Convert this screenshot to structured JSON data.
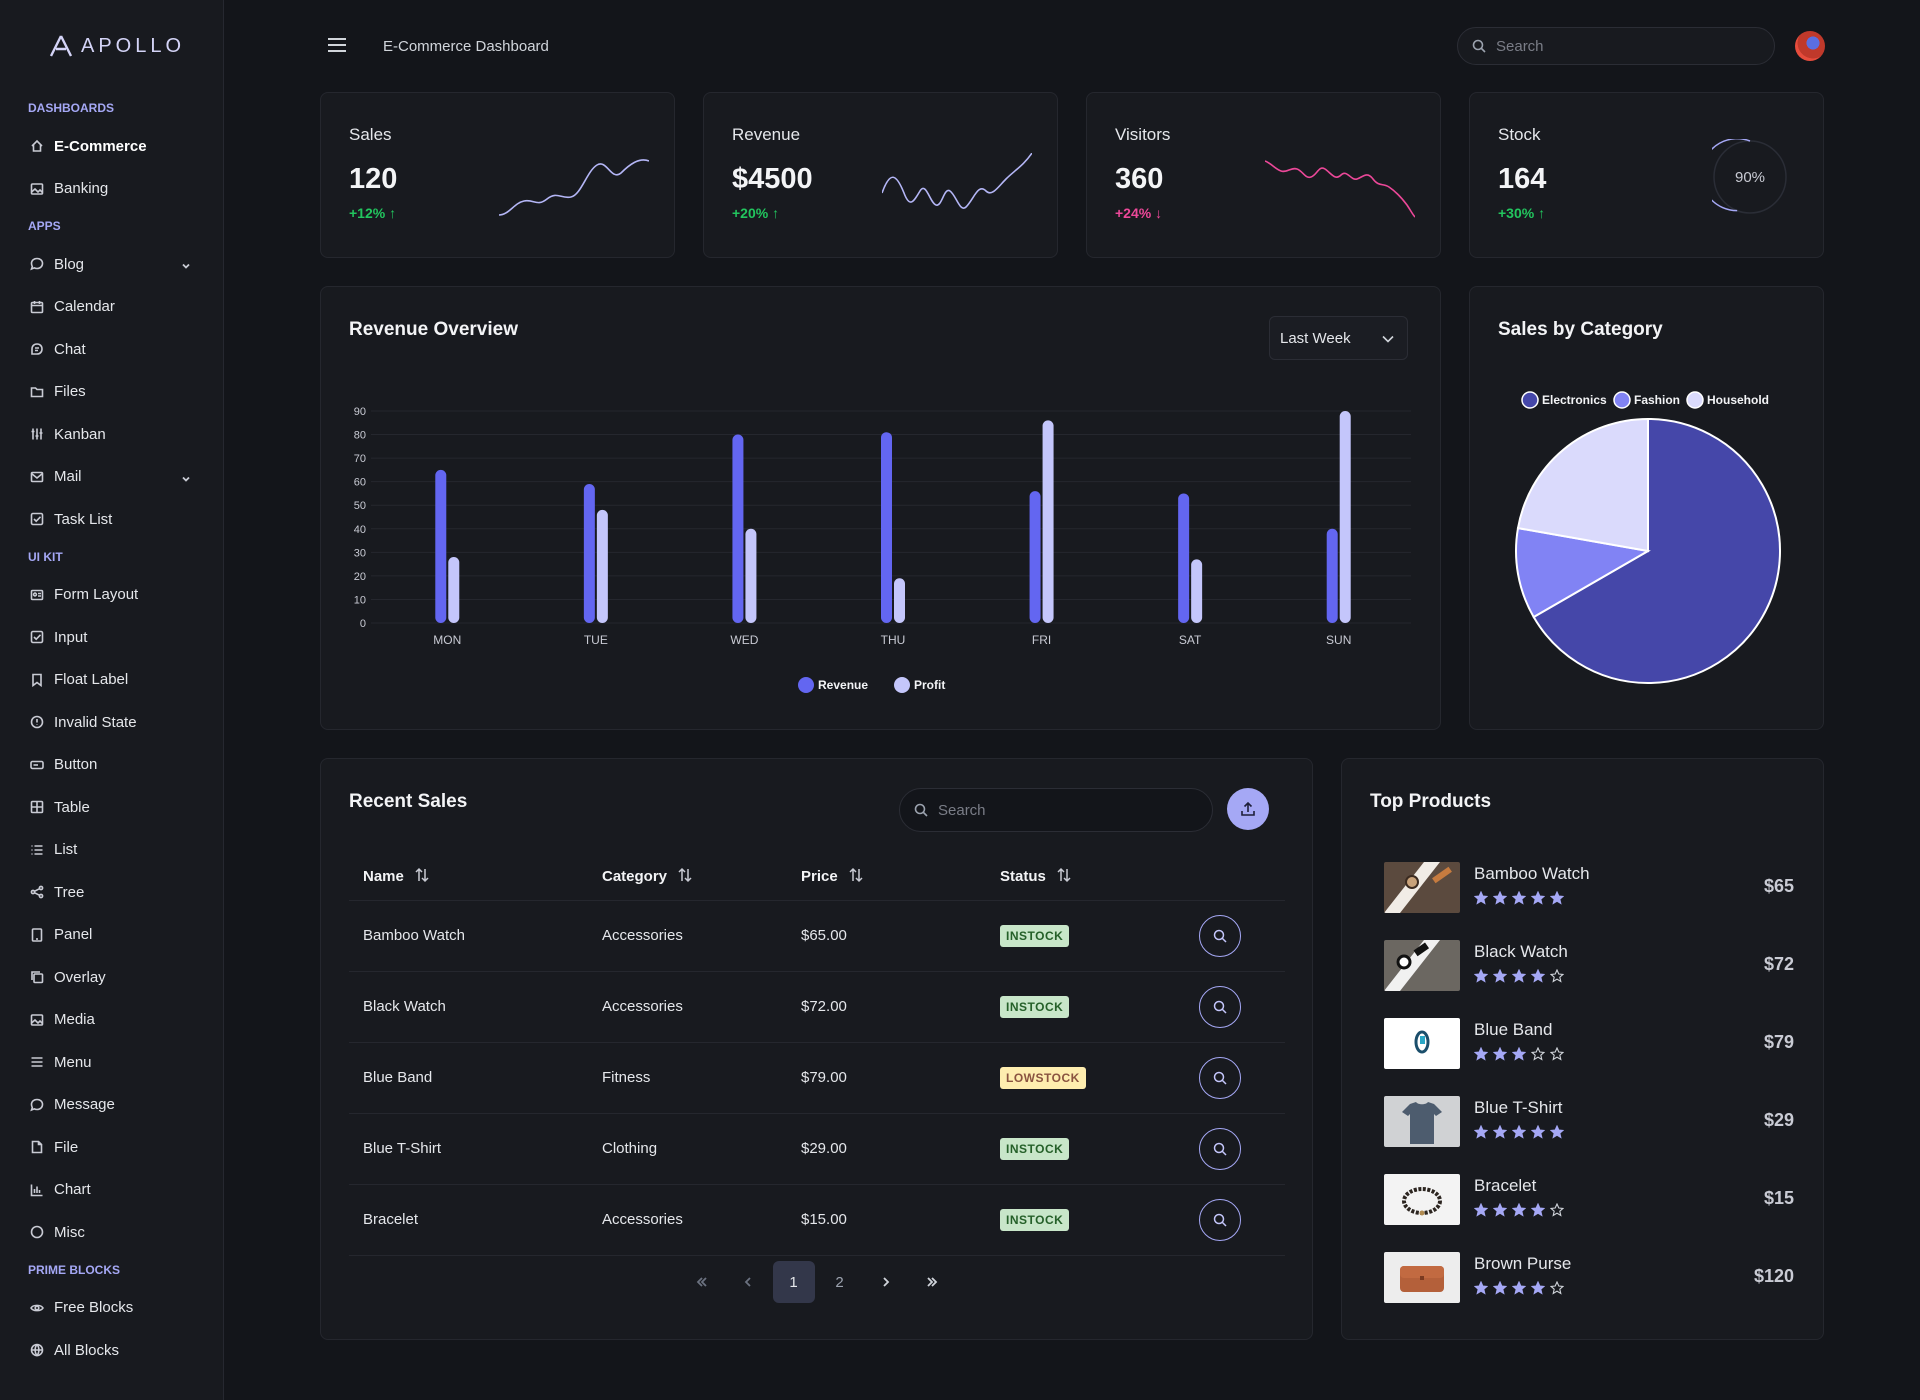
{
  "app": {
    "name": "APOLLO"
  },
  "sidebar": {
    "sections": [
      {
        "title": "DASHBOARDS",
        "items": [
          {
            "label": "E-Commerce",
            "icon": "home-icon",
            "active": true
          },
          {
            "label": "Banking",
            "icon": "image-icon"
          }
        ]
      },
      {
        "title": "APPS",
        "items": [
          {
            "label": "Blog",
            "icon": "comment-icon",
            "expandable": true
          },
          {
            "label": "Calendar",
            "icon": "calendar-icon"
          },
          {
            "label": "Chat",
            "icon": "chat-icon"
          },
          {
            "label": "Files",
            "icon": "folder-icon"
          },
          {
            "label": "Kanban",
            "icon": "sliders-icon"
          },
          {
            "label": "Mail",
            "icon": "envelope-icon",
            "expandable": true
          },
          {
            "label": "Task List",
            "icon": "check-square-icon"
          }
        ]
      },
      {
        "title": "UI KIT",
        "items": [
          {
            "label": "Form Layout",
            "icon": "id-card-icon"
          },
          {
            "label": "Input",
            "icon": "check-square-icon"
          },
          {
            "label": "Float Label",
            "icon": "bookmark-icon"
          },
          {
            "label": "Invalid State",
            "icon": "exclamation-circle-icon"
          },
          {
            "label": "Button",
            "icon": "button-icon"
          },
          {
            "label": "Table",
            "icon": "table-icon"
          },
          {
            "label": "List",
            "icon": "list-icon"
          },
          {
            "label": "Tree",
            "icon": "share-icon"
          },
          {
            "label": "Panel",
            "icon": "tablet-icon"
          },
          {
            "label": "Overlay",
            "icon": "clone-icon"
          },
          {
            "label": "Media",
            "icon": "image-icon"
          },
          {
            "label": "Menu",
            "icon": "bars-icon"
          },
          {
            "label": "Message",
            "icon": "comment-icon"
          },
          {
            "label": "File",
            "icon": "file-icon"
          },
          {
            "label": "Chart",
            "icon": "chart-bar-icon"
          },
          {
            "label": "Misc",
            "icon": "circle-icon"
          }
        ]
      },
      {
        "title": "PRIME BLOCKS",
        "items": [
          {
            "label": "Free Blocks",
            "icon": "eye-icon"
          },
          {
            "label": "All Blocks",
            "icon": "globe-icon"
          }
        ]
      }
    ]
  },
  "topbar": {
    "title": "E-Commerce Dashboard",
    "search_placeholder": "Search"
  },
  "stats": [
    {
      "title": "Sales",
      "value": "120",
      "change": "+12%",
      "direction": "up"
    },
    {
      "title": "Revenue",
      "value": "$4500",
      "change": "+20%",
      "direction": "up"
    },
    {
      "title": "Visitors",
      "value": "360",
      "change": "+24%",
      "direction": "down"
    },
    {
      "title": "Stock",
      "value": "164",
      "change": "+30%",
      "direction": "up",
      "gauge_label": "90%",
      "gauge_value": 0.9
    }
  ],
  "colors": {
    "accent": "#a5a8f5",
    "revenue": "#6366f1",
    "profit": "#c4c6fb",
    "up": "#22c55e",
    "down": "#ec4899",
    "electronics": "#4547a9",
    "fashion": "#8183f4",
    "household": "#dadafc"
  },
  "revenue_overview": {
    "title": "Revenue Overview",
    "period": "Last Week",
    "chart_data": {
      "type": "bar",
      "categories": [
        "MON",
        "TUE",
        "WED",
        "THU",
        "FRI",
        "SAT",
        "SUN"
      ],
      "series": [
        {
          "name": "Revenue",
          "values": [
            65,
            59,
            80,
            81,
            56,
            55,
            40
          ]
        },
        {
          "name": "Profit",
          "values": [
            28,
            48,
            40,
            19,
            86,
            27,
            90
          ]
        }
      ],
      "ylim": [
        0,
        90
      ],
      "yticks": [
        0,
        10,
        20,
        30,
        40,
        50,
        60,
        70,
        80,
        90
      ],
      "legend": "bottom",
      "grid": true
    }
  },
  "sales_by_category": {
    "title": "Sales by Category",
    "chart_data": {
      "type": "pie",
      "labels": [
        "Electronics",
        "Fashion",
        "Household"
      ],
      "values": [
        300,
        50,
        100
      ],
      "legend": "top"
    }
  },
  "recent_sales": {
    "title": "Recent Sales",
    "search_placeholder": "Search",
    "columns": [
      "Name",
      "Category",
      "Price",
      "Status"
    ],
    "rows": [
      {
        "name": "Bamboo Watch",
        "category": "Accessories",
        "price": "$65.00",
        "status": "INSTOCK"
      },
      {
        "name": "Black Watch",
        "category": "Accessories",
        "price": "$72.00",
        "status": "INSTOCK"
      },
      {
        "name": "Blue Band",
        "category": "Fitness",
        "price": "$79.00",
        "status": "LOWSTOCK"
      },
      {
        "name": "Blue T-Shirt",
        "category": "Clothing",
        "price": "$29.00",
        "status": "INSTOCK"
      },
      {
        "name": "Bracelet",
        "category": "Accessories",
        "price": "$15.00",
        "status": "INSTOCK"
      }
    ],
    "pages": [
      "1",
      "2"
    ],
    "current_page": "1"
  },
  "top_products": {
    "title": "Top Products",
    "items": [
      {
        "name": "Bamboo Watch",
        "rating": 5,
        "price": "$65"
      },
      {
        "name": "Black Watch",
        "rating": 4,
        "price": "$72"
      },
      {
        "name": "Blue Band",
        "rating": 3,
        "price": "$79"
      },
      {
        "name": "Blue T-Shirt",
        "rating": 5,
        "price": "$29"
      },
      {
        "name": "Bracelet",
        "rating": 4,
        "price": "$15"
      },
      {
        "name": "Brown Purse",
        "rating": 4,
        "price": "$120"
      }
    ]
  }
}
